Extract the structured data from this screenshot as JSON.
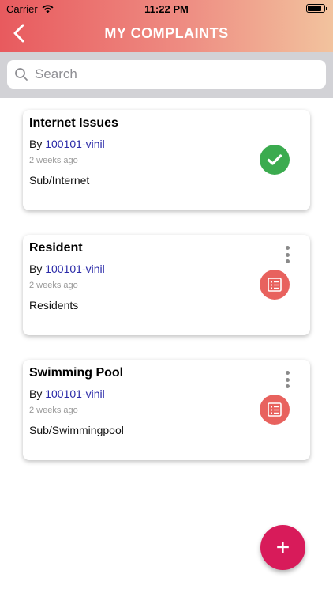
{
  "status_bar": {
    "carrier": "Carrier",
    "time": "11:22 PM"
  },
  "header": {
    "title": "MY COMPLAINTS",
    "back_icon": "chevron-left-icon"
  },
  "search": {
    "placeholder": "Search",
    "value": ""
  },
  "colors": {
    "header_gradient": [
      "#e85a5e",
      "#ee8c82",
      "#f2c39e"
    ],
    "resolved": "#3bab4f",
    "pending": "#e8625e",
    "fab": "#d81b5a",
    "user_link": "#2a2aa8"
  },
  "complaints": [
    {
      "title": "Internet Issues",
      "by_prefix": "By",
      "user": "100101-vinil",
      "time": "2 weeks ago",
      "category": "Sub/Internet",
      "status_icon": "check-icon"
    },
    {
      "title": "Resident",
      "by_prefix": "By",
      "user": "100101-vinil",
      "time": "2 weeks ago",
      "category": "Residents",
      "status_icon": "checklist-icon"
    },
    {
      "title": "Swimming Pool",
      "by_prefix": "By",
      "user": "100101-vinil",
      "time": "2 weeks ago",
      "category": "Sub/Swimmingpool",
      "status_icon": "checklist-icon"
    }
  ],
  "fab": {
    "label": "+",
    "icon": "plus-icon"
  }
}
